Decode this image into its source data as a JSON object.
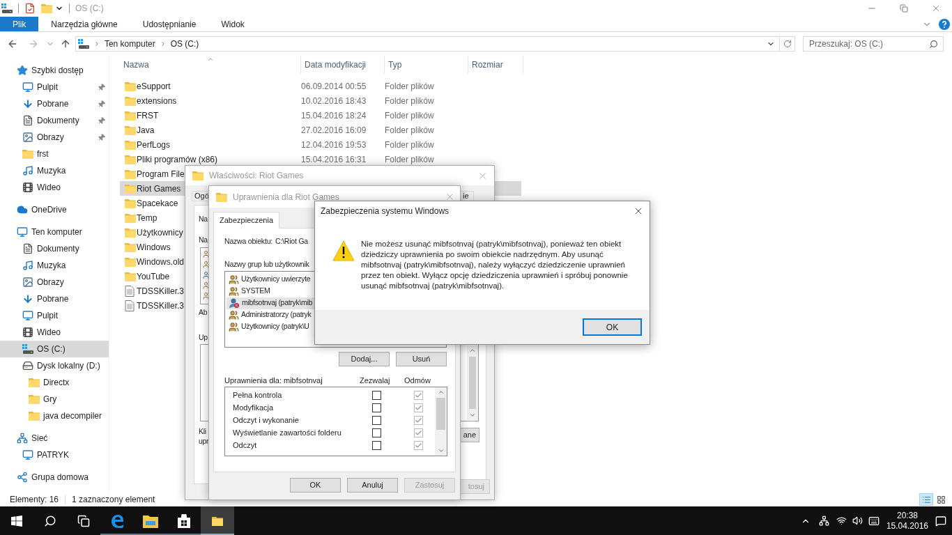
{
  "window": {
    "title": "OS (C:)"
  },
  "ribbon": {
    "tabs": [
      {
        "label": "Plik",
        "selected": true
      },
      {
        "label": "Narzędzia główne",
        "selected": false
      },
      {
        "label": "Udostępnianie",
        "selected": false
      },
      {
        "label": "Widok",
        "selected": false
      }
    ]
  },
  "nav": {
    "back": {
      "disabled": false
    },
    "forward": {
      "disabled": true
    }
  },
  "address": {
    "path": [
      "Ten komputer",
      "OS (C:)"
    ]
  },
  "search": {
    "placeholder": "Przeszukaj: OS (C:)"
  },
  "sidebar": {
    "items": [
      {
        "label": "Szybki dostęp",
        "selected": false,
        "children": [
          {
            "label": "Pulpit",
            "pinned": true,
            "selected": false
          },
          {
            "label": "Pobrane",
            "pinned": true,
            "selected": false
          },
          {
            "label": "Dokumenty",
            "pinned": true,
            "selected": false
          },
          {
            "label": "Obrazy",
            "pinned": true,
            "selected": false
          },
          {
            "label": "frst",
            "pinned": false,
            "selected": false
          },
          {
            "label": "Muzyka",
            "pinned": false,
            "selected": false
          },
          {
            "label": "Wideo",
            "pinned": false,
            "selected": false
          }
        ]
      },
      {
        "label": "OneDrive",
        "selected": false
      },
      {
        "label": "Ten komputer",
        "selected": false,
        "children": [
          {
            "label": "Dokumenty",
            "selected": false
          },
          {
            "label": "Muzyka",
            "selected": false
          },
          {
            "label": "Obrazy",
            "selected": false
          },
          {
            "label": "Pobrane",
            "selected": false
          },
          {
            "label": "Pulpit",
            "selected": false
          },
          {
            "label": "Wideo",
            "selected": false
          },
          {
            "label": "OS (C:)",
            "selected": true
          },
          {
            "label": "Dysk lokalny (D:)",
            "selected": false,
            "children": [
              {
                "label": "Directx",
                "selected": false
              },
              {
                "label": "Gry",
                "selected": false
              },
              {
                "label": "java decompiler",
                "selected": false
              }
            ]
          }
        ]
      },
      {
        "label": "Sieć",
        "selected": false,
        "children": [
          {
            "label": "PATRYK",
            "selected": false
          }
        ]
      },
      {
        "label": "Grupa domowa",
        "selected": false
      }
    ]
  },
  "files": {
    "columns": [
      {
        "label": "Nazwa",
        "sorted": true
      },
      {
        "label": "Data modyfikacji",
        "sorted": false
      },
      {
        "label": "Typ",
        "sorted": false
      },
      {
        "label": "Rozmiar",
        "sorted": false
      }
    ],
    "rows": [
      {
        "name": "eSupport",
        "date": "06.09.2014 00:55",
        "type": "Folder plików",
        "kind": "folder",
        "selected": false
      },
      {
        "name": "extensions",
        "date": "10.02.2016 18:43",
        "type": "Folder plików",
        "kind": "folder",
        "selected": false
      },
      {
        "name": "FRST",
        "date": "15.04.2016 18:24",
        "type": "Folder plików",
        "kind": "folder",
        "selected": false
      },
      {
        "name": "Java",
        "date": "27.02.2016 16:09",
        "type": "Folder plików",
        "kind": "folder",
        "selected": false
      },
      {
        "name": "PerfLogs",
        "date": "12.04.2016 19:53",
        "type": "Folder plików",
        "kind": "folder",
        "selected": false
      },
      {
        "name": "Pliki programów (x86)",
        "date": "15.04.2016 16:31",
        "type": "Folder plików",
        "kind": "folder",
        "selected": false
      },
      {
        "name": "Program File",
        "kind": "folder",
        "selected": false
      },
      {
        "name": "Riot Games",
        "kind": "folder",
        "selected": true
      },
      {
        "name": "Spacekace",
        "kind": "folder",
        "selected": false
      },
      {
        "name": "Temp",
        "kind": "folder",
        "selected": false
      },
      {
        "name": "Użytkownicy",
        "kind": "folder",
        "selected": false
      },
      {
        "name": "Windows",
        "kind": "folder",
        "selected": false
      },
      {
        "name": "Windows.old",
        "kind": "folder",
        "selected": false
      },
      {
        "name": "YouTube",
        "kind": "folder",
        "selected": false
      },
      {
        "name": "TDSSKiller.3",
        "kind": "file",
        "selected": false
      },
      {
        "name": "TDSSKiller.3",
        "kind": "file",
        "selected": false
      }
    ]
  },
  "status_bar": {
    "count": "Elementy: 16",
    "selection": "1 zaznaczony element",
    "views": [
      {
        "selected": true
      },
      {
        "selected": false
      }
    ]
  },
  "properties_dialog": {
    "title": "Właściwości: Riot Games",
    "tabs": [
      {
        "label": "Ogó",
        "selected": false
      },
      {
        "label": "ie",
        "selected": false
      }
    ],
    "labels": [
      "Na",
      "Na",
      "Ab",
      "Up",
      "Kli",
      "upr"
    ],
    "buttons": [
      {
        "label": "ane",
        "disabled": false
      },
      {
        "label": "tosuj",
        "disabled": true
      }
    ]
  },
  "permissions_dialog": {
    "title": "Uprawnienia dla Riot Games",
    "tabs": [
      {
        "label": "Zabezpieczenia",
        "selected": true
      }
    ],
    "object_label": "Nazwa obiektu:",
    "object_value": "C:\\Riot Ga",
    "groups_label": "Nazwy grup lub użytkownik",
    "groups": [
      {
        "name": "Użytkownicy uwierzyte",
        "kind": "group",
        "selected": false
      },
      {
        "name": "SYSTEM",
        "kind": "group",
        "selected": false
      },
      {
        "name": "mibfsotnvaj (patryk\\mib",
        "kind": "user",
        "selected": true
      },
      {
        "name": "Administratorzy (patryk",
        "kind": "group",
        "selected": false
      },
      {
        "name": "Użytkownicy (patryk\\U",
        "kind": "group",
        "selected": false
      }
    ],
    "group_buttons": [
      "Dodaj...",
      "Usuń"
    ],
    "permissions_label": "Uprawnienia dla: mibfsotnvaj",
    "allow_label": "Zezwalaj",
    "deny_label": "Odmów",
    "permissions": [
      {
        "name": "Pełna kontrola",
        "allow": false,
        "deny": true,
        "deny_disabled": true
      },
      {
        "name": "Modyfikacja",
        "allow": false,
        "deny": true,
        "deny_disabled": true
      },
      {
        "name": "Odczyt i wykonanie",
        "allow": false,
        "deny": true,
        "deny_disabled": true
      },
      {
        "name": "Wyświetlanie zawartości folderu",
        "allow": false,
        "deny": true,
        "deny_disabled": true
      },
      {
        "name": "Odczyt",
        "allow": false,
        "deny": true,
        "deny_disabled": true
      }
    ],
    "buttons": [
      {
        "label": "OK",
        "disabled": false
      },
      {
        "label": "Anuluj",
        "disabled": false
      },
      {
        "label": "Zastosuj",
        "disabled": true
      }
    ]
  },
  "message_dialog": {
    "title": "Zabezpieczenia systemu Windows",
    "message": "Nie możesz usunąć mibfsotnvaj (patryk\\mibfsotnvaj), ponieważ ten obiekt dziedziczy uprawnienia po swoim obiekcie nadrzędnym. Aby usunąć mibfsotnvaj (patryk\\mibfsotnvaj), należy wyłączyć dziedziczenie uprawnień przez ten obiekt. Wyłącz opcję dziedziczenia uprawnień i spróbuj ponownie usunąć mibfsotnvaj (patryk\\mibfsotnvaj).",
    "buttons": [
      {
        "label": "OK",
        "default": true
      }
    ]
  },
  "taskbar": {
    "apps": [
      {
        "running": true,
        "active": false
      },
      {
        "running": true,
        "active": false
      },
      {
        "running": true,
        "active": false
      },
      {
        "running": true,
        "active": true
      }
    ],
    "time": "20:38",
    "date": "15.04.2016"
  }
}
